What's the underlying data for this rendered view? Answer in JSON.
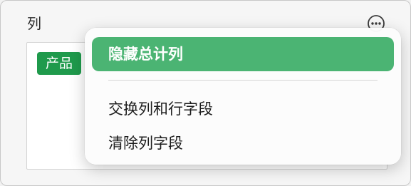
{
  "section": {
    "label": "列"
  },
  "field_well": {
    "chips": [
      {
        "label": "产品"
      }
    ]
  },
  "context_menu": {
    "items": [
      {
        "label": "隐藏总计列",
        "highlighted": true
      },
      {
        "label": "交换列和行字段",
        "highlighted": false
      },
      {
        "label": "清除列字段",
        "highlighted": false
      }
    ]
  },
  "icons": {
    "more": "more-options-icon"
  },
  "colors": {
    "chip_background": "#1f9a4c",
    "highlight_background": "#4bb473",
    "panel_background": "#f6f6f6",
    "menu_background": "#fcfcfc"
  }
}
